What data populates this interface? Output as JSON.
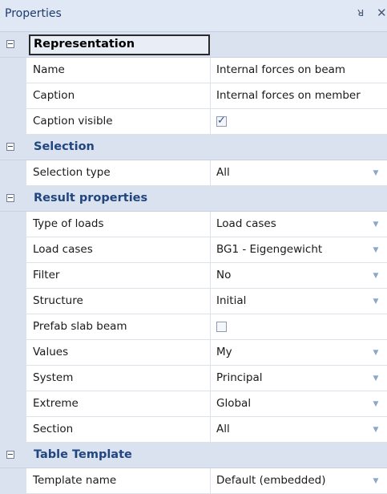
{
  "panel": {
    "title": "Properties",
    "pin_glyph": "ᵖ",
    "close_glyph": "×"
  },
  "categories": [
    {
      "label": "Representation",
      "rows": [
        {
          "name": "Name",
          "value": "Internal forces on beam"
        },
        {
          "name": "Caption",
          "value": "Internal forces on member"
        },
        {
          "name": "Caption visible",
          "checkbox": true
        }
      ]
    },
    {
      "label": "Selection",
      "rows": [
        {
          "name": "Selection type",
          "value": "All",
          "dropdown": true
        }
      ]
    },
    {
      "label": "Result properties",
      "rows": [
        {
          "name": "Type of loads",
          "value": "Load cases",
          "dropdown": true
        },
        {
          "name": "Load cases",
          "value": "BG1 - Eigengewicht",
          "dropdown": true
        },
        {
          "name": "Filter",
          "value": "No",
          "dropdown": true
        },
        {
          "name": "Structure",
          "value": "Initial",
          "dropdown": true
        },
        {
          "name": "Prefab slab beam",
          "checkbox": false
        },
        {
          "name": "Values",
          "value": "My",
          "dropdown": true
        },
        {
          "name": "System",
          "value": "Principal",
          "dropdown": true
        },
        {
          "name": "Extreme",
          "value": "Global",
          "dropdown": true
        },
        {
          "name": "Section",
          "value": "All",
          "dropdown": true
        }
      ]
    },
    {
      "label": "Table Template",
      "rows": [
        {
          "name": "Template name",
          "value": "Default (embedded)",
          "dropdown": true
        }
      ]
    }
  ],
  "icons": {
    "collapse": "minus-box-icon",
    "dropdown": "chevron-down-icon",
    "pin": "pin-icon",
    "close": "close-icon"
  },
  "colors": {
    "category_bg": "#dae2ef",
    "category_text": "#21467f",
    "title_bar": "#dfe8f4"
  }
}
